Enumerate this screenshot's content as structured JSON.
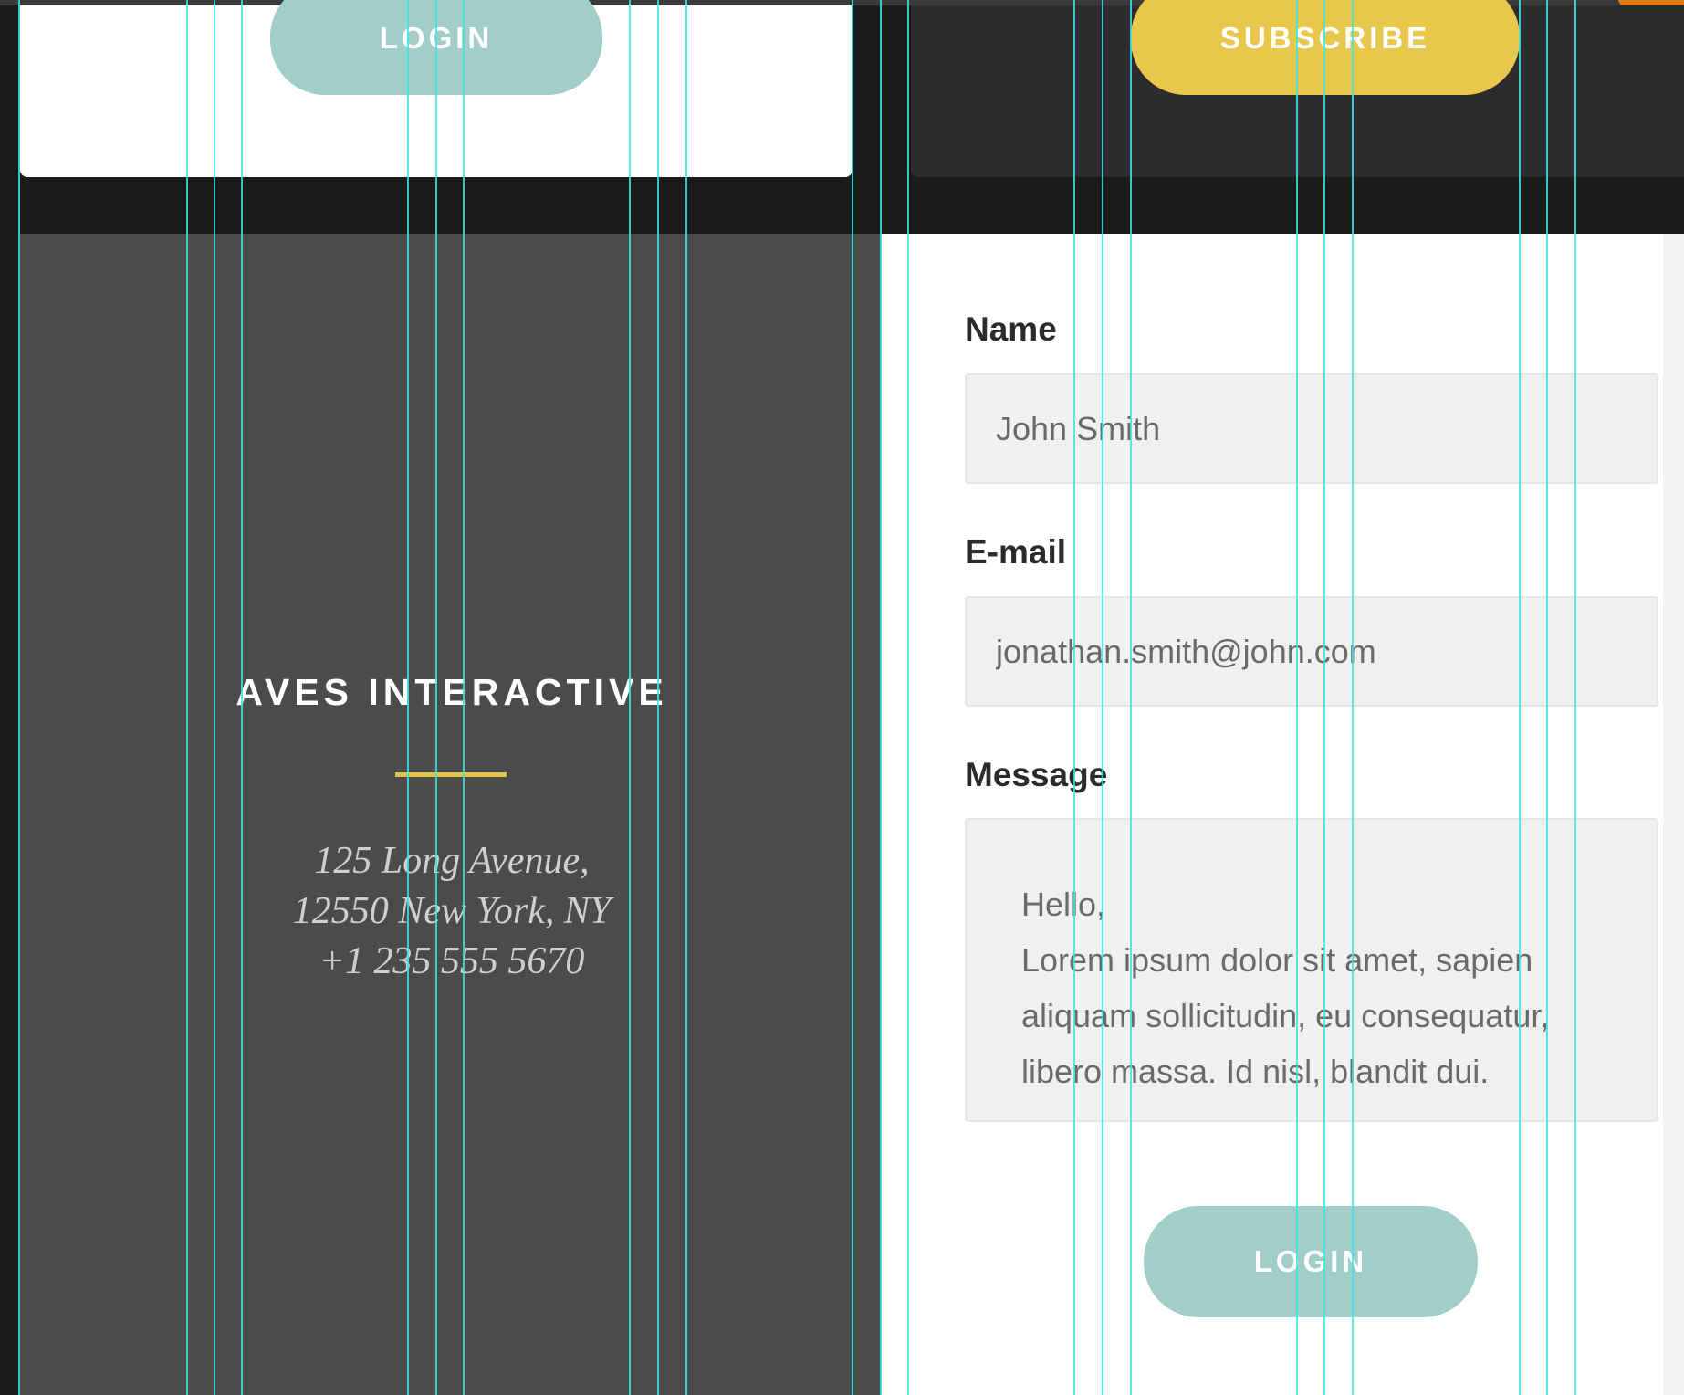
{
  "colors": {
    "background": "#1b1b1b",
    "teal_button": "#a1cec8",
    "yellow_button": "#e7c84c",
    "left_panel": "#4b4b4b",
    "dark_card": "#2e2b2f",
    "accent_rule": "#e2c247",
    "guides": "#37e6e6",
    "orange_accent": "#e07b16"
  },
  "top": {
    "login_label": "LOGIN",
    "subscribe_label": "SUBSCRIBE"
  },
  "contact": {
    "company": "AVES INTERACTIVE",
    "address_line1": "125 Long Avenue,",
    "address_line2": "12550 New York, NY",
    "phone": "+1 235 555 5670"
  },
  "form": {
    "name_label": "Name",
    "name_value": "John Smith",
    "email_label": "E-mail",
    "email_value": "jonathan.smith@john.com",
    "message_label": "Message",
    "message_value": "Hello,\nLorem ipsum dolor sit amet, sapien\naliquam sollicitudin, eu consequatur,\nlibero massa. Id nisl, blandit dui.",
    "submit_label": "LOGIN"
  },
  "guides_visible": true
}
